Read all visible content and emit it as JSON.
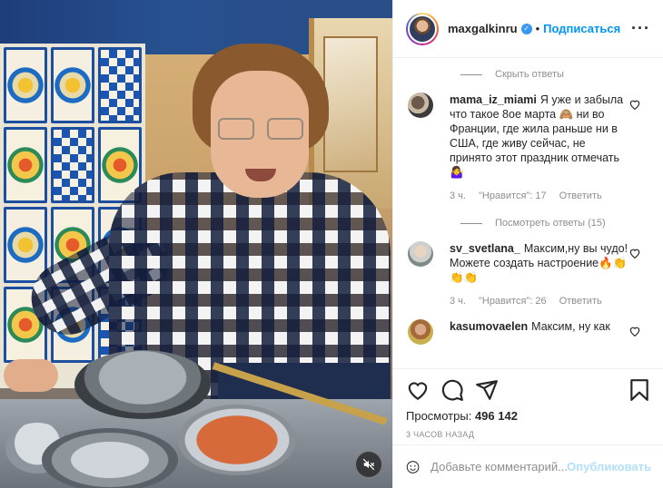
{
  "header": {
    "username": "maxgalkinru",
    "verified_icon": "verified-badge-icon",
    "separator": "•",
    "follow_label": "Подписаться",
    "more_icon": "more-horizontal-icon",
    "more_glyph": "···"
  },
  "comments": {
    "hide_replies_label": "Скрыть ответы",
    "view_replies_label": "Посмотреть ответы (15)",
    "items": [
      {
        "username": "mama_iz_miami",
        "text": "Я уже и забыла что такое 8ое марта 🙈 ни во Франции, где жила раньше ни в США, где живу сейчас, не принято этот праздник отмечать 🤷‍♀️",
        "time": "3 ч.",
        "likes": "\"Нравится\": 17",
        "reply": "Ответить"
      },
      {
        "username": "sv_svetlana_",
        "text": "Максим,ну вы чудо!Можете создать настроение🔥👏👏👏",
        "time": "3 ч.",
        "likes": "\"Нравится\": 26",
        "reply": "Ответить"
      },
      {
        "username": "kasumovaelen",
        "text": "Максим, ну как"
      }
    ]
  },
  "actions": {
    "like_icon": "heart-icon",
    "comment_icon": "comment-icon",
    "share_icon": "share-icon",
    "save_icon": "bookmark-icon",
    "views_label": "Просмотры:",
    "views_count": "496 142",
    "time_ago": "3 ЧАСОВ НАЗАД"
  },
  "add_comment": {
    "emoji_icon": "emoji-icon",
    "placeholder": "Добавьте комментарий...",
    "post_label": "Опубликовать"
  },
  "video": {
    "mute_icon": "volume-muted-icon"
  },
  "colors": {
    "accent": "#0095f6",
    "post_disabled": "#b2dffc",
    "muted_text": "#8e8e8e",
    "text": "#262626"
  }
}
